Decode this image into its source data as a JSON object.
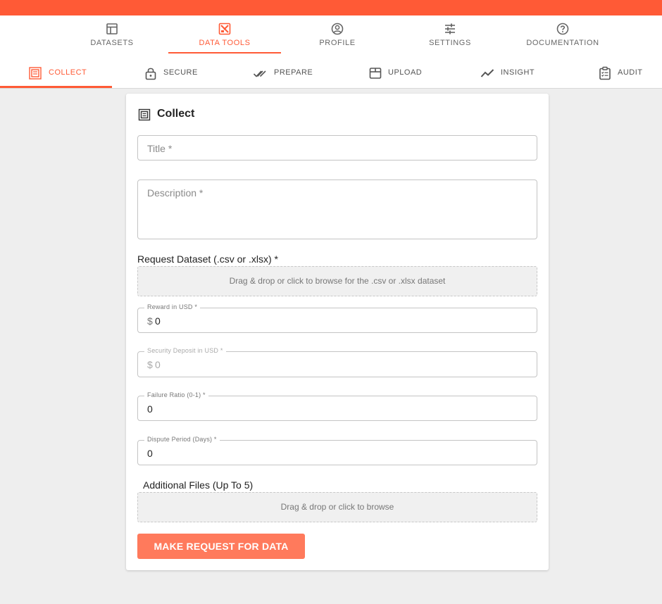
{
  "colors": {
    "accent": "#ff5a36",
    "button": "#ff7a5c"
  },
  "main_nav": [
    {
      "label": "DATASETS",
      "icon": "table-icon"
    },
    {
      "label": "DATA TOOLS",
      "icon": "tools-icon",
      "active": true
    },
    {
      "label": "PROFILE",
      "icon": "user-circle-icon"
    },
    {
      "label": "SETTINGS",
      "icon": "sliders-icon"
    },
    {
      "label": "DOCUMENTATION",
      "icon": "help-circle-icon"
    }
  ],
  "sub_nav": [
    {
      "label": "COLLECT",
      "icon": "collect-icon",
      "active": true
    },
    {
      "label": "SECURE",
      "icon": "lock-icon"
    },
    {
      "label": "PREPARE",
      "icon": "double-check-icon"
    },
    {
      "label": "UPLOAD",
      "icon": "box-icon"
    },
    {
      "label": "INSIGHT",
      "icon": "trend-line-icon"
    },
    {
      "label": "AUDIT",
      "icon": "clipboard-icon"
    }
  ],
  "form": {
    "title": "Collect",
    "title_placeholder": "Title *",
    "description_placeholder": "Description *",
    "request_dataset_label": "Request Dataset (.csv or .xlsx) *",
    "request_dataset_drop": "Drag & drop or click to browse for the .csv or .xlsx dataset",
    "reward_label": "Reward in USD *",
    "reward_prefix": "$",
    "reward_value": "0",
    "deposit_label": "Security Deposit in USD *",
    "deposit_prefix": "$",
    "deposit_value": "0",
    "failure_label": "Failure Ratio (0-1) *",
    "failure_value": "0",
    "dispute_label": "Dispute Period (Days) *",
    "dispute_value": "0",
    "additional_files_label": "Additional Files (Up To 5)",
    "additional_files_drop": "Drag & drop or click to browse",
    "submit_label": "MAKE REQUEST FOR DATA"
  }
}
